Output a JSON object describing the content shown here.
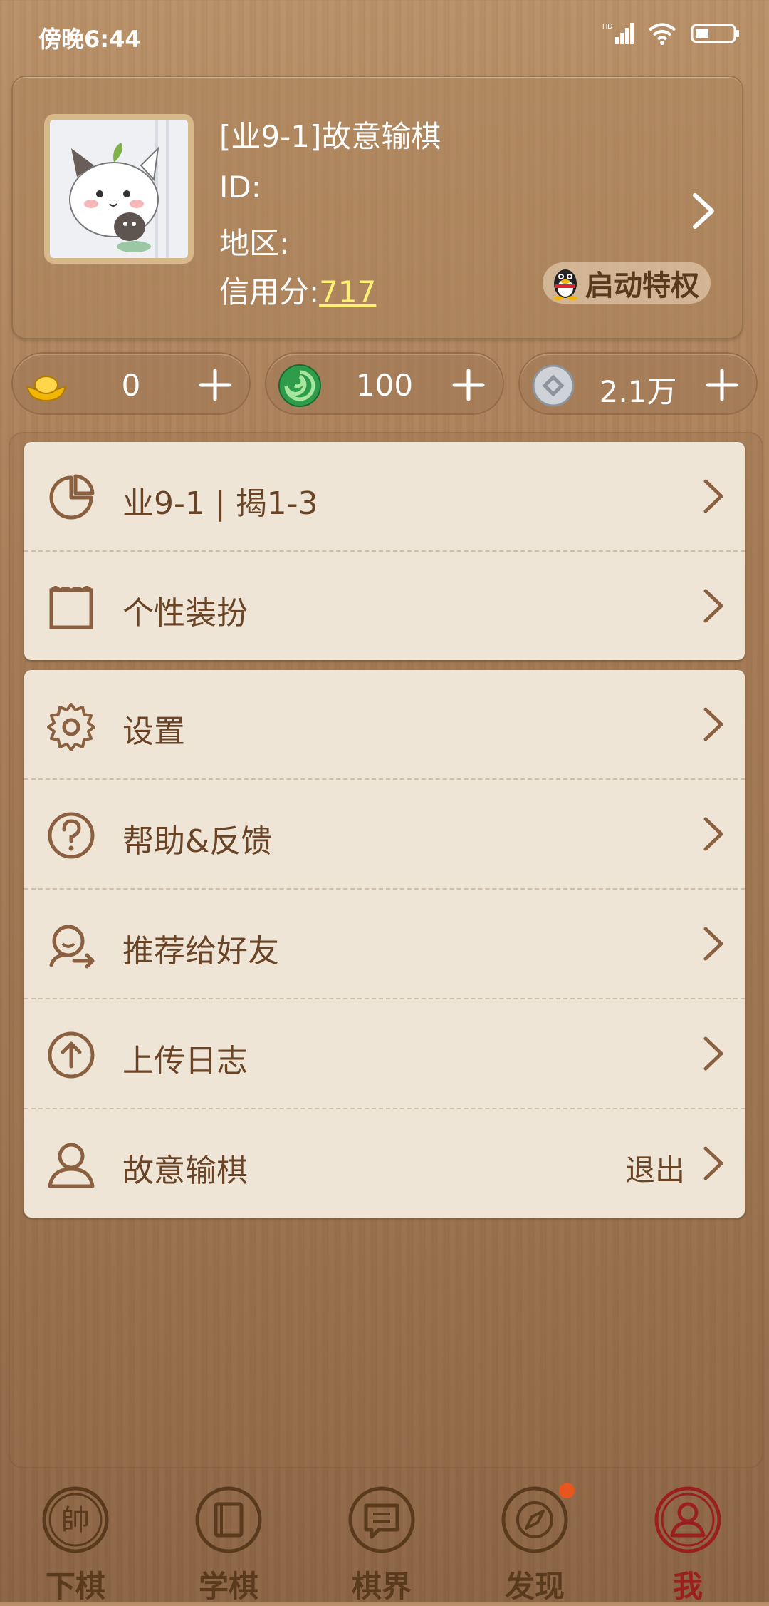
{
  "status_bar": {
    "time": "傍晚6:44"
  },
  "profile": {
    "name": "[业9-1]故意输棋",
    "id_label": "ID:",
    "region_label": "地区:",
    "credit_label": "信用分:",
    "credit_value": "717",
    "privilege_button": "启动特权"
  },
  "currencies": [
    {
      "icon": "gold-ingot-icon",
      "value": "0"
    },
    {
      "icon": "jade-icon",
      "value": "100"
    },
    {
      "icon": "coin-icon",
      "value": "2.1万"
    }
  ],
  "menu_group_1": [
    {
      "icon": "pie-chart-icon",
      "label": "业9-1 | 揭1-3"
    },
    {
      "icon": "scroll-frame-icon",
      "label": "个性装扮"
    }
  ],
  "menu_group_2": [
    {
      "icon": "gear-icon",
      "label": "设置"
    },
    {
      "icon": "help-icon",
      "label": "帮助&反馈"
    },
    {
      "icon": "share-icon",
      "label": "推荐给好友"
    },
    {
      "icon": "upload-icon",
      "label": "上传日志"
    },
    {
      "icon": "user-icon",
      "label": "故意输棋",
      "right_text": "退出"
    }
  ],
  "bottom_nav": [
    {
      "icon": "chess-piece-icon",
      "label": "下棋"
    },
    {
      "icon": "book-icon",
      "label": "学棋"
    },
    {
      "icon": "forum-icon",
      "label": "棋界"
    },
    {
      "icon": "compass-icon",
      "label": "发现",
      "badge": true
    },
    {
      "icon": "me-icon",
      "label": "我",
      "active": true
    }
  ],
  "colors": {
    "accent_credit": "#fff176",
    "active_tab": "#9b1f1f",
    "badge": "#e8551d"
  }
}
